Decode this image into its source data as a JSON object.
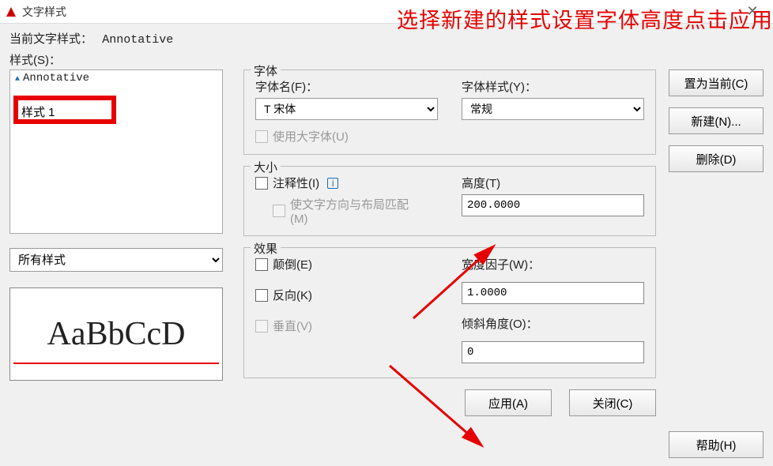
{
  "window": {
    "title": "文字样式"
  },
  "annotation": "选择新建的样式设置字体高度点击应用",
  "current_style": {
    "label": "当前文字样式：",
    "value": "Annotative"
  },
  "styles": {
    "label": "样式(S)：",
    "items": [
      {
        "name": "Annotative",
        "annotative": true
      },
      {
        "name": "样式 1",
        "annotative": false
      }
    ],
    "selected_display": "样式 1",
    "filter_selected": "所有样式",
    "filter_options": [
      "所有样式"
    ]
  },
  "preview_text": "AaBbCcD",
  "font": {
    "group_label": "字体",
    "name_label": "字体名(F)：",
    "name_value": "宋体",
    "style_label": "字体样式(Y)：",
    "style_value": "常规",
    "bigfont_label": "使用大字体(U)"
  },
  "size": {
    "group_label": "大小",
    "annotative_label": "注释性(I)",
    "match_layout_label": "使文字方向与布局匹配(M)",
    "height_label": "高度(T)",
    "height_value": "200.0000"
  },
  "effects": {
    "group_label": "效果",
    "upside_down_label": "颠倒(E)",
    "backwards_label": "反向(K)",
    "vertical_label": "垂直(V)",
    "width_factor_label": "宽度因子(W)：",
    "width_factor_value": "1.0000",
    "oblique_label": "倾斜角度(O)：",
    "oblique_value": "0"
  },
  "buttons": {
    "set_current": "置为当前(C)",
    "new": "新建(N)...",
    "delete": "删除(D)",
    "apply": "应用(A)",
    "close": "关闭(C)",
    "help": "帮助(H)"
  }
}
